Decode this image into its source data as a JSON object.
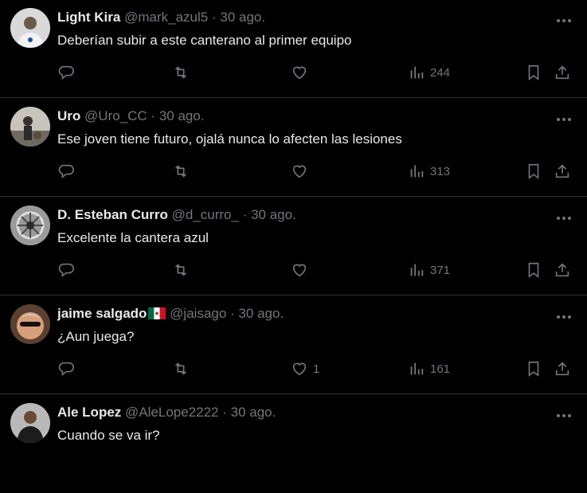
{
  "tweets": [
    {
      "name": "Light Kira",
      "handle": "@mark_azul5",
      "separator": "·",
      "date": "30 ago.",
      "text": "Deberían subir a este canterano al primer equipo",
      "likes": "",
      "views": "244",
      "flag": false
    },
    {
      "name": "Uro",
      "handle": "@Uro_CC",
      "separator": "·",
      "date": "30 ago.",
      "text": "Ese joven tiene futuro, ojalá nunca lo afecten las lesiones",
      "likes": "",
      "views": "313",
      "flag": false
    },
    {
      "name": "D. Esteban Curro",
      "handle": "@d_curro_",
      "separator": "·",
      "date": "30 ago.",
      "text": "Excelente la cantera azul",
      "likes": "",
      "views": "371",
      "flag": false
    },
    {
      "name": "jaime salgado",
      "handle": "@jaisago",
      "separator": "·",
      "date": "30 ago.",
      "text": "¿Aun juega?",
      "likes": "1",
      "views": "161",
      "flag": true
    },
    {
      "name": "Ale Lopez",
      "handle": "@AleLope2222",
      "separator": "·",
      "date": "30 ago.",
      "text": "Cuando se va ir?",
      "likes": "",
      "views": "",
      "flag": false
    }
  ],
  "icons": {
    "reply": "reply-icon",
    "retweet": "retweet-icon",
    "like": "heart-icon",
    "views": "views-bar-chart-icon",
    "bookmark": "bookmark-icon",
    "share": "share-icon",
    "more": "more-dots-icon"
  },
  "colors": {
    "background": "#000000",
    "text": "#e7e9ea",
    "muted": "#71767b",
    "divider": "#2f3336"
  }
}
